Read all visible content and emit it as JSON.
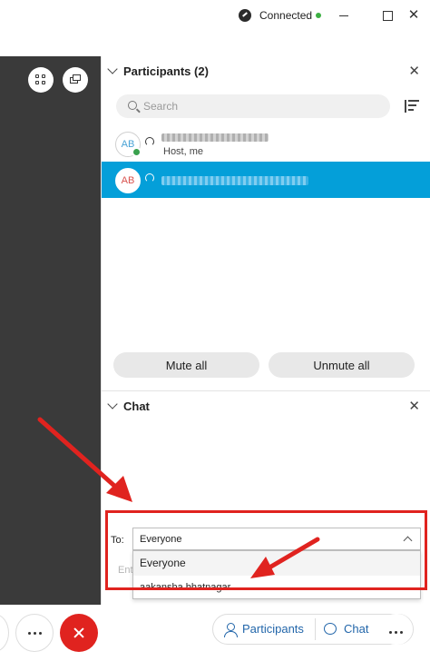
{
  "titlebar": {
    "status": "Connected",
    "status_color": "#3cb043",
    "controls": [
      "minimize-icon",
      "maximize-icon",
      "close-icon"
    ],
    "close_glyph": "✕"
  },
  "participants": {
    "title": "Participants (2)",
    "close_glyph": "✕",
    "search_placeholder": "Search",
    "list": [
      {
        "initials": "AB",
        "subtitle": "Host, me",
        "selected": false
      },
      {
        "initials": "AB",
        "subtitle": "",
        "selected": true
      }
    ],
    "mute_all": "Mute all",
    "unmute_all": "Unmute all"
  },
  "chat": {
    "title": "Chat",
    "close_glyph": "✕",
    "to_label": "To:",
    "to_value": "Everyone",
    "message_hint": "Ent",
    "dropdown_options": [
      "Everyone",
      "aakansha bhatnagar"
    ]
  },
  "toolbar": {
    "participants_label": "Participants",
    "chat_label": "Chat"
  },
  "colors": {
    "accent": "#049fd9",
    "end_call": "#e0231f",
    "annotation": "#e0231f",
    "link": "#2266aa"
  }
}
